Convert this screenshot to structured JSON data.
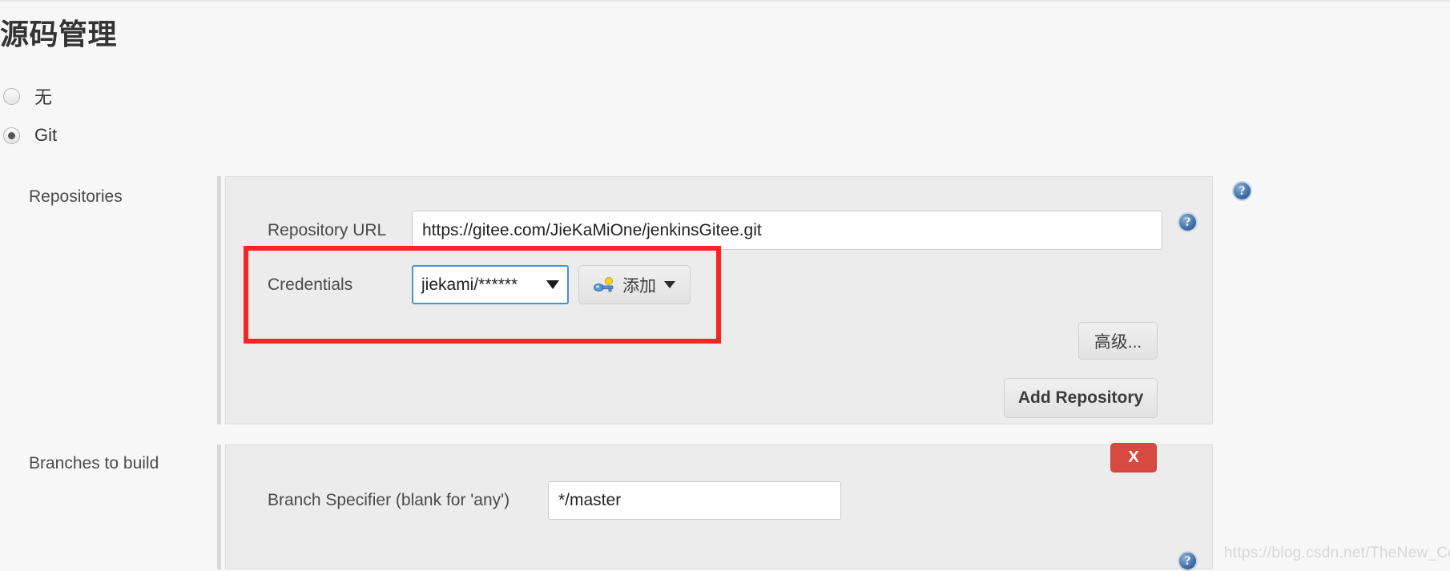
{
  "page": {
    "title": "源码管理"
  },
  "scm_options": [
    {
      "label": "无",
      "selected": false,
      "name": "none"
    },
    {
      "label": "Git",
      "selected": true,
      "name": "git"
    }
  ],
  "repositories": {
    "section_label": "Repositories",
    "repository_url": {
      "label": "Repository URL",
      "value": "https://gitee.com/JieKaMiOne/jenkinsGitee.git"
    },
    "credentials": {
      "label": "Credentials",
      "selected_value": "jiekami/******",
      "add_button_label": "添加"
    },
    "advanced_button_label": "高级...",
    "add_repository_button_label": "Add Repository"
  },
  "branches": {
    "section_label": "Branches to build",
    "branch_specifier": {
      "label": "Branch Specifier (blank for 'any')",
      "value": "*/master"
    },
    "delete_button_label": "X"
  },
  "help": {
    "glyph": "?"
  },
  "watermark": "https://blog.csdn.net/TheNew_Cd",
  "colors": {
    "highlight_red": "#fb2424",
    "delete_red": "#d64a41",
    "focus_blue": "#4a90d9",
    "panel_bg": "#ececec",
    "page_bg": "#f7f7f7"
  }
}
